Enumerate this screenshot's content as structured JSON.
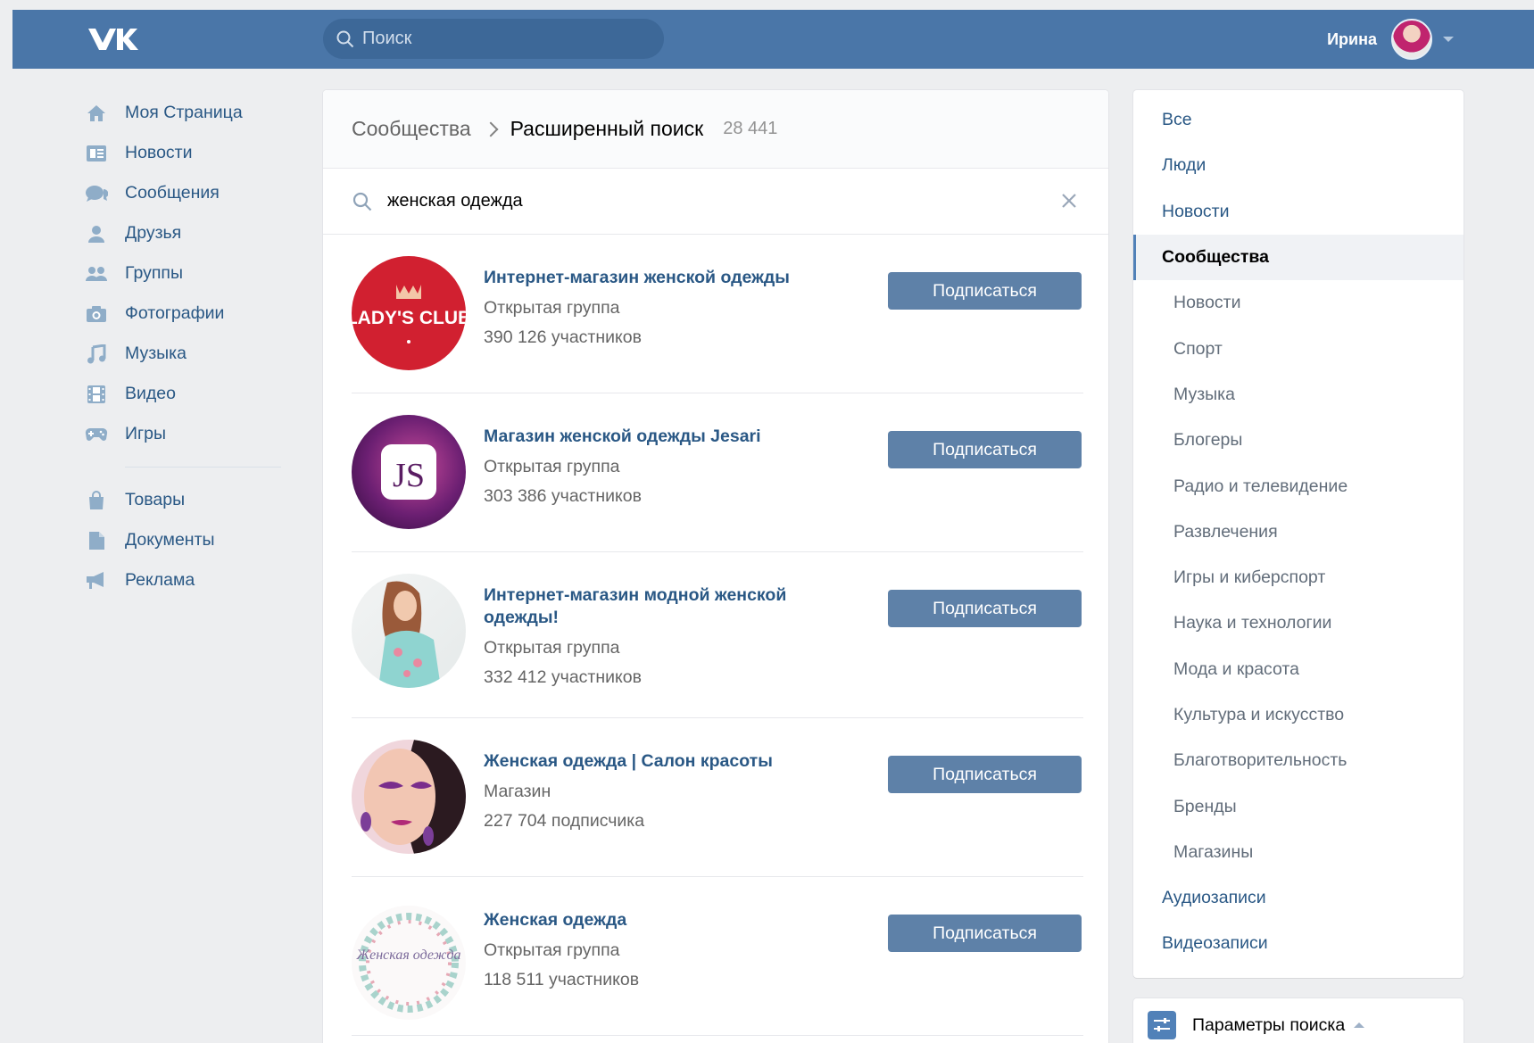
{
  "header": {
    "logo_icon": "vk-logo-icon",
    "search_placeholder": "Поиск",
    "user_name": "Ирина"
  },
  "nav": {
    "items": [
      {
        "label": "Моя Страница",
        "icon": "home-icon"
      },
      {
        "label": "Новости",
        "icon": "news-icon"
      },
      {
        "label": "Сообщения",
        "icon": "messages-icon"
      },
      {
        "label": "Друзья",
        "icon": "friends-icon"
      },
      {
        "label": "Группы",
        "icon": "groups-icon"
      },
      {
        "label": "Фотографии",
        "icon": "camera-icon"
      },
      {
        "label": "Музыка",
        "icon": "music-icon"
      },
      {
        "label": "Видео",
        "icon": "video-icon"
      },
      {
        "label": "Игры",
        "icon": "gamepad-icon"
      }
    ],
    "items2": [
      {
        "label": "Товары",
        "icon": "shopping-bag-icon"
      },
      {
        "label": "Документы",
        "icon": "document-icon"
      },
      {
        "label": "Реклама",
        "icon": "megaphone-icon"
      }
    ]
  },
  "main": {
    "breadcrumb_root": "Сообщества",
    "breadcrumb_current": "Расширенный поиск",
    "result_count": "28 441",
    "query": "женская одежда",
    "subscribe_label": "Подписаться",
    "results": [
      {
        "title": "Интернет-магазин женской одежды",
        "type": "Открытая группа",
        "count": "390 126 участников",
        "avatar_text": "LADY'S CLUB"
      },
      {
        "title": "Магазин женской одежды Jesari",
        "type": "Открытая группа",
        "count": "303 386 участников",
        "avatar_text": "JS"
      },
      {
        "title": "Интернет-магазин модной женской одежды!",
        "type": "Открытая группа",
        "count": "332 412 участников"
      },
      {
        "title": "Женская одежда | Салон красоты",
        "type": "Магазин",
        "count": "227 704 подписчика"
      },
      {
        "title": "Женская одежда",
        "type": "Открытая группа",
        "count": "118 511 участников",
        "avatar_text": "Женская одежда"
      }
    ]
  },
  "filter": {
    "items": [
      {
        "label": "Все",
        "kind": "top"
      },
      {
        "label": "Люди",
        "kind": "top"
      },
      {
        "label": "Новости",
        "kind": "top"
      },
      {
        "label": "Сообщества",
        "kind": "active"
      },
      {
        "label": "Новости",
        "kind": "sub"
      },
      {
        "label": "Спорт",
        "kind": "sub"
      },
      {
        "label": "Музыка",
        "kind": "sub"
      },
      {
        "label": "Блогеры",
        "kind": "sub"
      },
      {
        "label": "Радио и телевидение",
        "kind": "sub"
      },
      {
        "label": "Развлечения",
        "kind": "sub"
      },
      {
        "label": "Игры и киберспорт",
        "kind": "sub"
      },
      {
        "label": "Наука и технологии",
        "kind": "sub"
      },
      {
        "label": "Мода и красота",
        "kind": "sub"
      },
      {
        "label": "Культура и искусство",
        "kind": "sub"
      },
      {
        "label": "Благотворительность",
        "kind": "sub"
      },
      {
        "label": "Бренды",
        "kind": "sub"
      },
      {
        "label": "Магазины",
        "kind": "sub"
      },
      {
        "label": "Аудиозаписи",
        "kind": "top"
      },
      {
        "label": "Видеозаписи",
        "kind": "top"
      }
    ],
    "params_label": "Параметры поиска"
  },
  "colors": {
    "header_bg": "#4a76a8",
    "link": "#2a5885",
    "button": "#5e81a8",
    "page_bg": "#edeef0"
  }
}
